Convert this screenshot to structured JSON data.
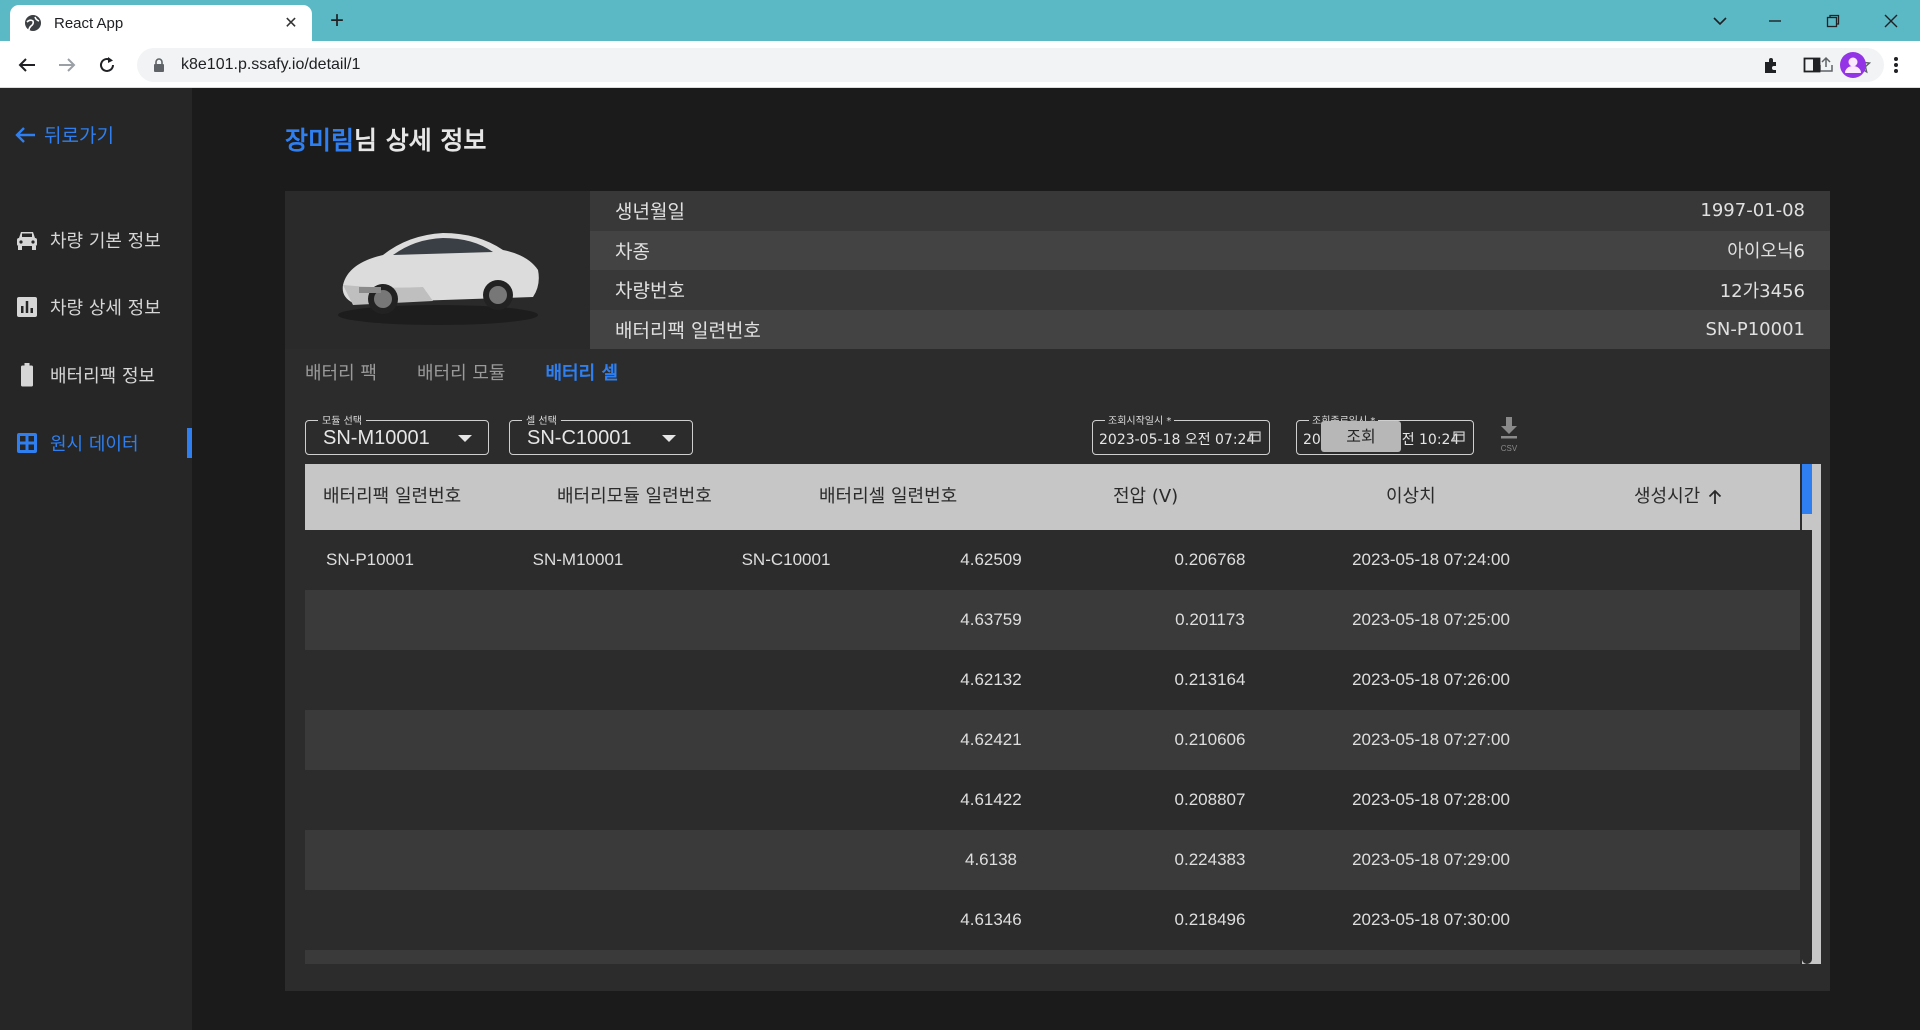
{
  "browser": {
    "tab_title": "React App",
    "url": "k8e101.p.ssafy.io/detail/1"
  },
  "sidebar": {
    "back_label": "뒤로가기",
    "items": [
      {
        "label": "차량 기본 정보",
        "icon": "car-icon"
      },
      {
        "label": "차량 상세 정보",
        "icon": "bar-chart-icon"
      },
      {
        "label": "배터리팩 정보",
        "icon": "battery-icon"
      },
      {
        "label": "원시 데이터",
        "icon": "grid-icon",
        "active": true
      }
    ]
  },
  "header": {
    "name": "장미림",
    "suffix": "님 상세 정보"
  },
  "info": {
    "rows": [
      {
        "label": "생년월일",
        "value": "1997-01-08"
      },
      {
        "label": "차종",
        "value": "아이오닉6"
      },
      {
        "label": "차량번호",
        "value": "12가3456"
      },
      {
        "label": "배터리팩 일련번호",
        "value": "SN-P10001"
      }
    ]
  },
  "tabs": [
    "배터리 팩",
    "배터리 모듈",
    "배터리 셀"
  ],
  "active_tab": "배터리 셀",
  "filters": {
    "module_label": "모듈 선택",
    "module_value": "SN-M10001",
    "cell_label": "셀 선택",
    "cell_value": "SN-C10001",
    "start_label": "조회시작일시 *",
    "start_value": "2023-05-18 오전 07:24",
    "end_label": "조회종료일시 *",
    "end_value": "2023-05-18 오전 10:24",
    "query_button": "조회",
    "csv_label": "CSV"
  },
  "table": {
    "columns": [
      "배터리팩 일련번호",
      "배터리모듈 일련번호",
      "배터리셀 일련번호",
      "전압 (V)",
      "이상치",
      "생성시간"
    ],
    "rows": [
      [
        "SN-P10001",
        "SN-M10001",
        "SN-C10001",
        "4.62509",
        "0.206768",
        "2023-05-18 07:24:00"
      ],
      [
        "",
        "",
        "",
        "4.63759",
        "0.201173",
        "2023-05-18 07:25:00"
      ],
      [
        "",
        "",
        "",
        "4.62132",
        "0.213164",
        "2023-05-18 07:26:00"
      ],
      [
        "",
        "",
        "",
        "4.62421",
        "0.210606",
        "2023-05-18 07:27:00"
      ],
      [
        "",
        "",
        "",
        "4.61422",
        "0.208807",
        "2023-05-18 07:28:00"
      ],
      [
        "",
        "",
        "",
        "4.6138",
        "0.224383",
        "2023-05-18 07:29:00"
      ],
      [
        "",
        "",
        "",
        "4.61346",
        "0.218496",
        "2023-05-18 07:30:00"
      ],
      [
        "",
        "",
        "",
        "",
        "",
        ""
      ]
    ]
  },
  "colors": {
    "accent": "#2f7ff0",
    "browser_frame": "#5bb8c5"
  }
}
